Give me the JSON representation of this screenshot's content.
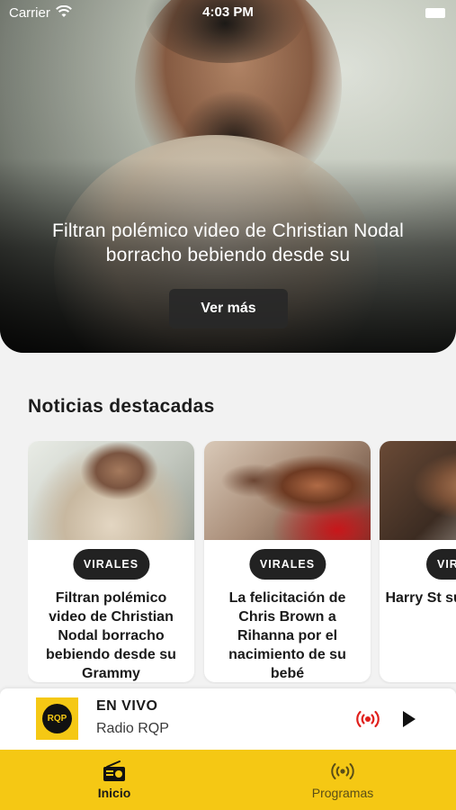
{
  "status_bar": {
    "carrier": "Carrier",
    "time": "4:03 PM"
  },
  "hero": {
    "title": "Filtran polémico video de Christian Nodal borracho bebiendo desde su",
    "button_label": "Ver más"
  },
  "section": {
    "title": "Noticias destacadas"
  },
  "cards": [
    {
      "tag": "VIRALES",
      "title": "Filtran polémico video de Christian Nodal borracho bebiendo desde su Grammy"
    },
    {
      "tag": "VIRALES",
      "title": "La felicitación de Chris Brown a Rihanna por el nacimiento de su bebé"
    },
    {
      "tag": "VIR",
      "title": "Harry St su esper disco « Ho"
    }
  ],
  "player": {
    "logo_text": "RQP",
    "live_label": "EN VIVO",
    "station": "Radio RQP",
    "accent_color": "#e0201c"
  },
  "tabs": [
    {
      "label": "Inicio",
      "icon": "radio-icon",
      "active": true
    },
    {
      "label": "Programas",
      "icon": "broadcast-icon",
      "active": false
    }
  ],
  "colors": {
    "brand_yellow": "#f5c814",
    "dark": "#222222"
  }
}
